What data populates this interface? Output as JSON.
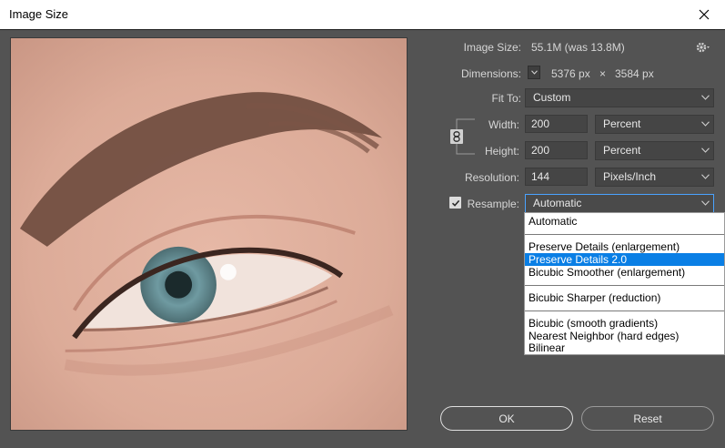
{
  "window": {
    "title": "Image Size"
  },
  "info": {
    "image_size_label": "Image Size:",
    "image_size_value": "55.1M (was 13.8M)",
    "dimensions_label": "Dimensions:",
    "dim_width": "5376 px",
    "dim_x": "×",
    "dim_height": "3584 px"
  },
  "fit_to": {
    "label": "Fit To:",
    "value": "Custom"
  },
  "width": {
    "label": "Width:",
    "value": "200",
    "unit": "Percent"
  },
  "height": {
    "label": "Height:",
    "value": "200",
    "unit": "Percent"
  },
  "resolution": {
    "label": "Resolution:",
    "value": "144",
    "unit": "Pixels/Inch"
  },
  "resample": {
    "label": "Resample:",
    "checked": true,
    "value": "Automatic",
    "options": [
      "Automatic",
      "Preserve Details (enlargement)",
      "Preserve Details 2.0",
      "Bicubic Smoother (enlargement)",
      "Bicubic Sharper (reduction)",
      "Bicubic (smooth gradients)",
      "Nearest Neighbor (hard edges)",
      "Bilinear"
    ],
    "highlighted": "Preserve Details 2.0"
  },
  "buttons": {
    "ok": "OK",
    "reset": "Reset"
  },
  "colors": {
    "panel": "#535353",
    "accent": "#0a7fe5",
    "focus": "#4aa3ff"
  }
}
